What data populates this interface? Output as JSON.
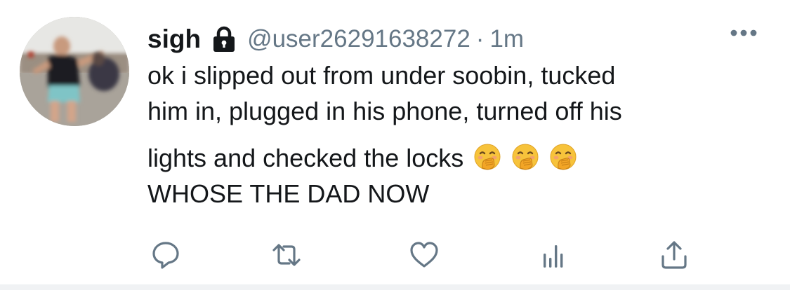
{
  "tweet": {
    "display_name": "sigh",
    "handle": "@user26291638272",
    "separator": "·",
    "timestamp": "1m",
    "is_protected": true,
    "lines": [
      "ok i slipped out from under soobin, tucked",
      "him in, plugged in his phone, turned off his",
      "lights and checked the locks",
      "WHOSE THE DAD NOW"
    ],
    "emoji": [
      "face-with-hand-over-mouth",
      "face-with-hand-over-mouth",
      "face-with-hand-over-mouth"
    ]
  },
  "actions": [
    {
      "name": "reply",
      "icon": "reply-icon"
    },
    {
      "name": "retweet",
      "icon": "retweet-icon"
    },
    {
      "name": "like",
      "icon": "heart-icon"
    },
    {
      "name": "analytics",
      "icon": "analytics-icon"
    },
    {
      "name": "share",
      "icon": "share-icon"
    }
  ],
  "colors": {
    "text": "#14171a",
    "secondary": "#657786",
    "icon": "#657786",
    "emoji_face": "#f7c33b"
  }
}
